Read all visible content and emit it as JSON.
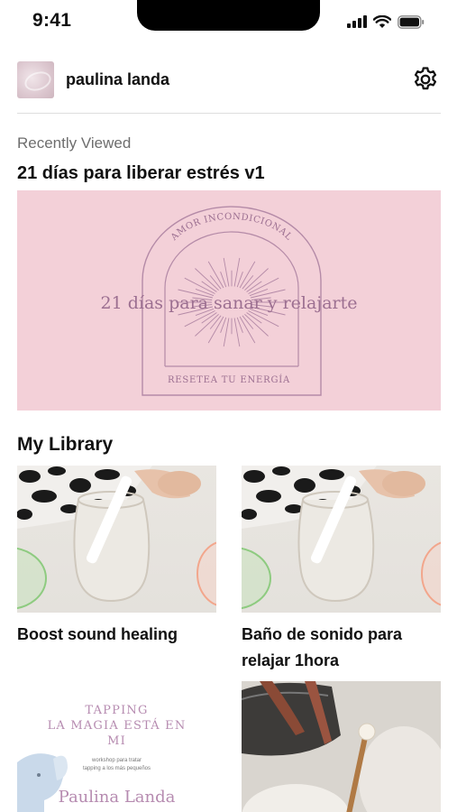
{
  "status_bar": {
    "time": "9:41"
  },
  "profile": {
    "name": "paulina landa"
  },
  "recent": {
    "section_label": "Recently Viewed",
    "title": "21 días para liberar estrés v1",
    "cover": {
      "arc_text": "AMOR INCONDICIONAL",
      "headline": "21 días para sanar y relajarte",
      "footer_text": "RESETEA TU ENERGÍA",
      "background_color": "#f3d0d8",
      "ink_color": "#9c6f91"
    }
  },
  "library": {
    "title": "My Library",
    "items": [
      {
        "title": "Boost sound healing",
        "thumb": "sound-bowls-photo"
      },
      {
        "title": "Baño de sonido para relajar 1hora",
        "thumb": "sound-bowls-photo"
      },
      {
        "title": "",
        "thumb": "tapping-cover",
        "cover_title": "TAPPING\nLA MAGIA ESTÁ EN\nMI",
        "cover_subtitle": "workshop para tratar\ntapping a los más pequeños",
        "cover_name": "Paulina Landa"
      },
      {
        "title": "",
        "thumb": "singing-bowl-mallet-photo"
      }
    ]
  },
  "icons": {
    "settings": "gear-icon",
    "signal": "cellular-signal-icon",
    "wifi": "wifi-icon",
    "battery": "battery-icon"
  }
}
